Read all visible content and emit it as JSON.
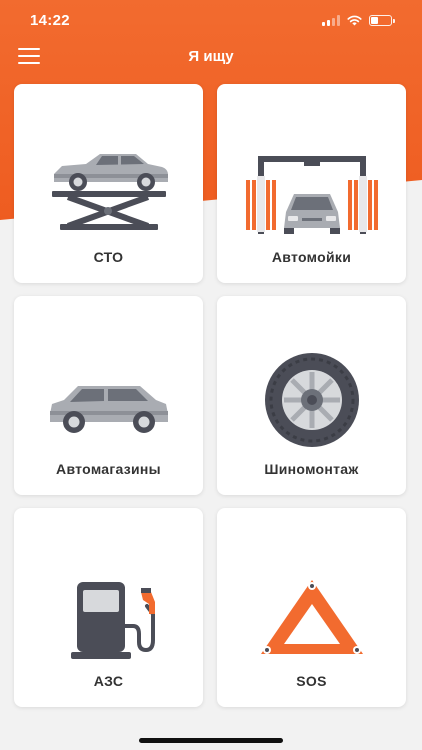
{
  "status": {
    "time": "14:22",
    "battery_level": 0.35
  },
  "header": {
    "title": "Я ищу",
    "menu_icon": "hamburger-menu-icon"
  },
  "categories": [
    {
      "label": "СТО",
      "icon": "car-lift-icon"
    },
    {
      "label": "Автомойки",
      "icon": "car-wash-icon"
    },
    {
      "label": "Автомагазины",
      "icon": "suv-car-icon"
    },
    {
      "label": "Шиномонтаж",
      "icon": "tire-icon"
    },
    {
      "label": "АЗС",
      "icon": "fuel-pump-icon"
    },
    {
      "label": "SOS",
      "icon": "warning-triangle-icon"
    }
  ],
  "colors": {
    "accent": "#ee5b1f",
    "card": "#ffffff",
    "text": "#333333"
  }
}
